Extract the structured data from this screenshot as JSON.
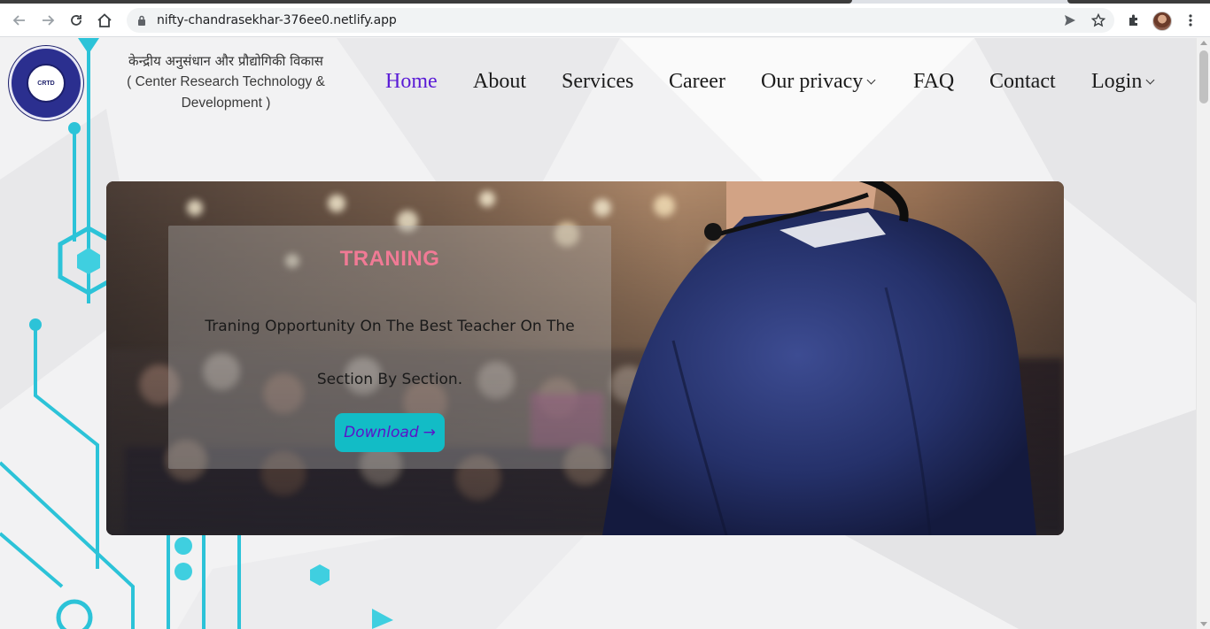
{
  "browser": {
    "url": "nifty-chandrasekhar-376ee0.netlify.app",
    "back_icon": "arrow-left-icon",
    "forward_icon": "arrow-right-icon",
    "reload_icon": "reload-icon",
    "home_icon": "home-icon"
  },
  "header": {
    "brand_hindi": "केन्द्रीय अनुसंधान और प्रौद्योगिकी विकास",
    "brand_english": "( Center Research Technology & Development )",
    "logo_text": "CRTD"
  },
  "nav": {
    "items": [
      {
        "label": "Home",
        "active": true
      },
      {
        "label": "About"
      },
      {
        "label": "Services"
      },
      {
        "label": "Career"
      },
      {
        "label": "Our privacy",
        "dropdown": true
      },
      {
        "label": "FAQ"
      },
      {
        "label": "Contact"
      },
      {
        "label": "Login",
        "dropdown": true
      }
    ]
  },
  "hero": {
    "title": "TRANING",
    "description": "Traning Opportunity On The Best Teacher On The Section By Section.",
    "button_label": "Download",
    "button_arrow": "→"
  },
  "colors": {
    "accent_purple": "#5a1bd6",
    "title_pink": "#f07a95",
    "button_teal": "#12bcc6",
    "circuit_teal": "#2cc3d8"
  }
}
